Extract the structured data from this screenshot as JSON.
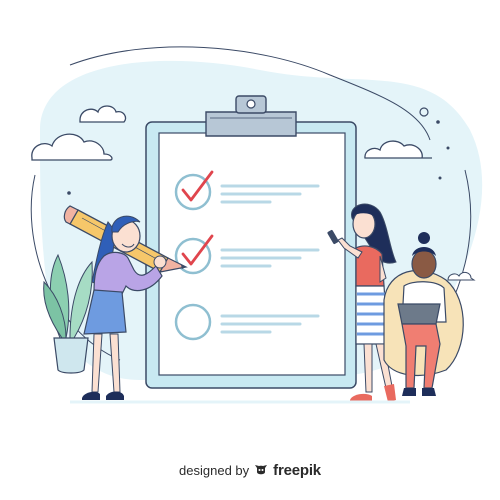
{
  "credit": {
    "designed_by": "designed by",
    "brand": "freepik",
    "logo_icon": "freepik-logo-icon"
  },
  "checklist": {
    "items": [
      {
        "checked": true
      },
      {
        "checked": true
      },
      {
        "checked": false
      }
    ]
  },
  "colors": {
    "outline": "#3b4a66",
    "clipboard_frame": "#c8e9f2",
    "clipboard_paper": "#ffffff",
    "clip": "#b7c7d6",
    "backdrop": "#e4f4f9",
    "check": "#e0454d",
    "circle": "#8fbfd1",
    "line": "#b8d8e6",
    "hair_blue": "#2f5fb8",
    "hair_dark": "#1e2e5a",
    "sweater": "#b9a4e6",
    "skirt": "#6e9be0",
    "top_red": "#e96a5f",
    "pants_red": "#f07e72",
    "laptop": "#6d7a8a",
    "beanbag": "#f7e3b8",
    "pencil_body": "#f6c76a",
    "pencil_tip": "#f1b3a2",
    "leaf": "#8ccfb1",
    "pot": "#cfe7ee",
    "skin_light": "#fbe0d2",
    "skin_dark": "#8a5a44"
  }
}
